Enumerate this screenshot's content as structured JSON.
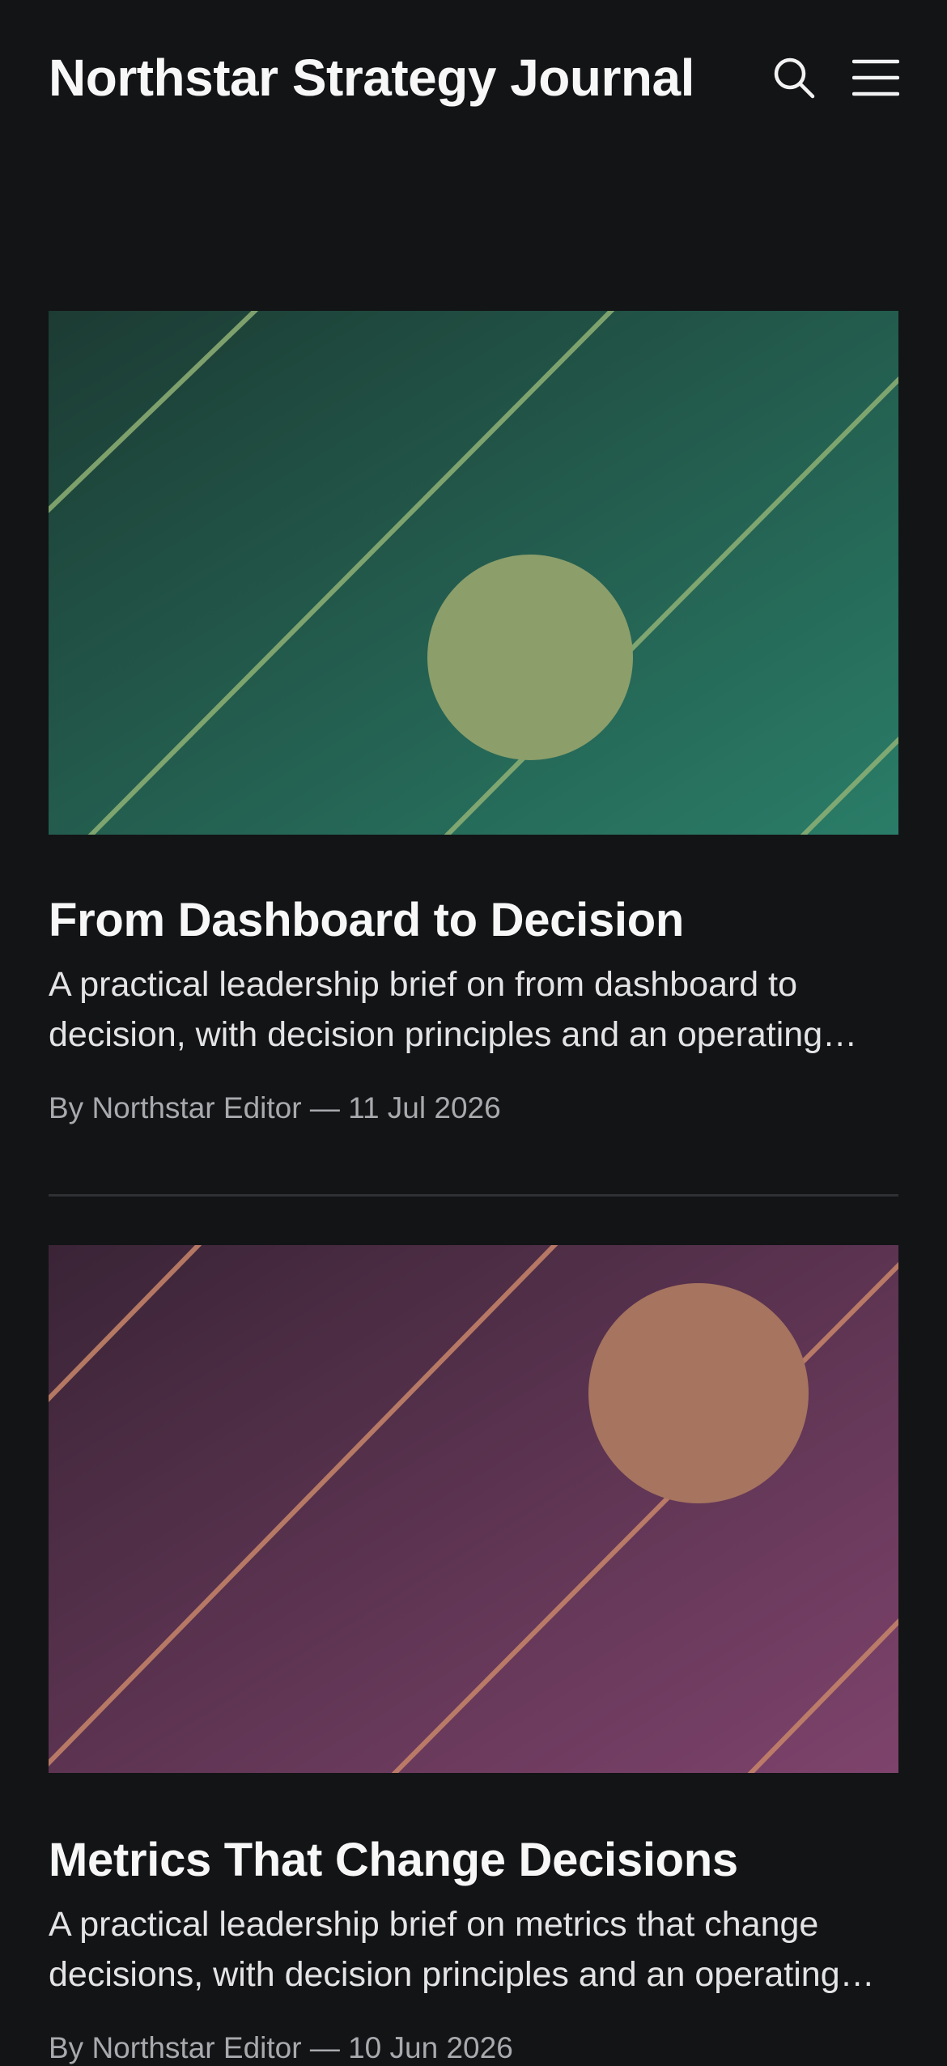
{
  "header": {
    "site_title": "Northstar Strategy Journal",
    "search_icon": "search-icon",
    "menu_icon": "hamburger-menu-icon"
  },
  "articles": [
    {
      "title": "From Dashboard to Decision",
      "excerpt": "A practical leadership brief on from dashboard to decision, with decision principles and an operating rhythm.",
      "byline": "By Northstar Editor — 11 Jul 2026",
      "image": {
        "description": "abstract-diagonal-lines-circle",
        "colors": {
          "gradient_start": "#1c3b33",
          "gradient_end": "#2a7d68",
          "line": "#8fb175",
          "circle": "#8c9e6a"
        }
      }
    },
    {
      "title": "Metrics That Change Decisions",
      "excerpt": "A practical leadership brief on metrics that change decisions, with decision principles and an operating rhythm.",
      "byline": "By Northstar Editor — 10 Jun 2026",
      "image": {
        "description": "abstract-diagonal-lines-circle",
        "colors": {
          "gradient_start": "#3a2436",
          "gradient_end": "#7e436c",
          "line": "#c8866a",
          "circle": "#a6745f"
        }
      }
    }
  ]
}
